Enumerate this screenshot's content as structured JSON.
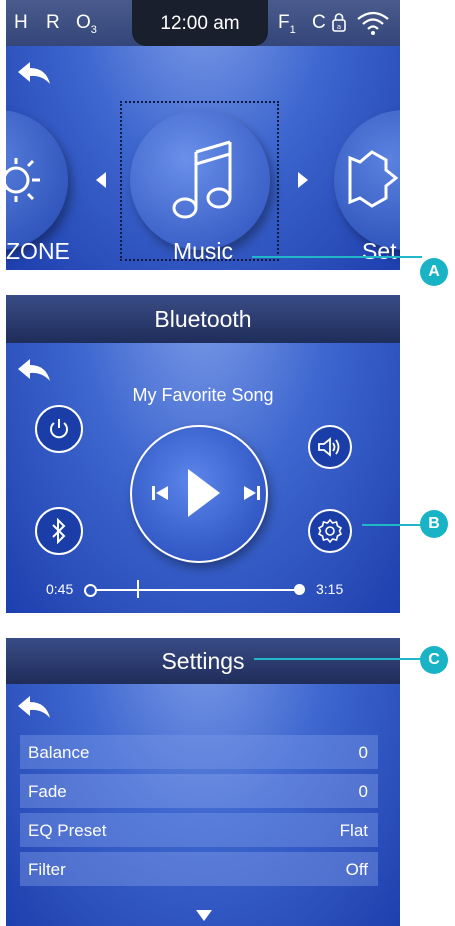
{
  "screen1": {
    "status": {
      "h": "H",
      "r": "R",
      "o": "O",
      "o_sub": "3",
      "time": "12:00 am",
      "f": "F",
      "f_sub": "1",
      "c": "C"
    },
    "carousel": {
      "left_label": "ZONE",
      "center_label": "Music",
      "right_label": "Set"
    },
    "callout": "A"
  },
  "screen2": {
    "title": "Bluetooth",
    "song": "My Favorite Song",
    "elapsed": "0:45",
    "total": "3:15",
    "progress_fraction": 0.23,
    "callout": "B"
  },
  "screen3": {
    "title": "Settings",
    "rows": [
      {
        "label": "Balance",
        "value": "0"
      },
      {
        "label": "Fade",
        "value": "0"
      },
      {
        "label": "EQ Preset",
        "value": "Flat"
      },
      {
        "label": "Filter",
        "value": "Off"
      }
    ],
    "callout": "C"
  },
  "colors": {
    "accent": "#19b3c6",
    "bar": "#1f2d5a",
    "panel": "#3e67cf"
  }
}
